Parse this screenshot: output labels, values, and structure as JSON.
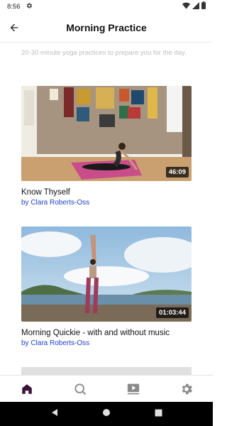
{
  "status_bar": {
    "time": "8:56",
    "icons": [
      "settings-icon",
      "wifi-icon",
      "signal-icon",
      "battery-icon"
    ]
  },
  "header": {
    "title": "Morning Practice",
    "back_icon": "arrow-left-icon"
  },
  "description": "20-30 minute yoga practices to prepare you for the day.",
  "videos": [
    {
      "title": "Know Thyself",
      "author": "by Clara Roberts-Oss",
      "duration": "46:09"
    },
    {
      "title": "Morning Quickie - with and without music",
      "author": "by Clara Roberts-Oss",
      "duration": "01:03:44"
    }
  ],
  "bottom_nav": {
    "items": [
      "home-icon",
      "search-icon",
      "video-library-icon",
      "settings-icon"
    ],
    "active": "home-icon",
    "active_color": "#3d1238",
    "inactive_color": "#8a8a8a"
  },
  "colors": {
    "author_link": "#1e40c8",
    "description_text": "#bdbdbd"
  }
}
